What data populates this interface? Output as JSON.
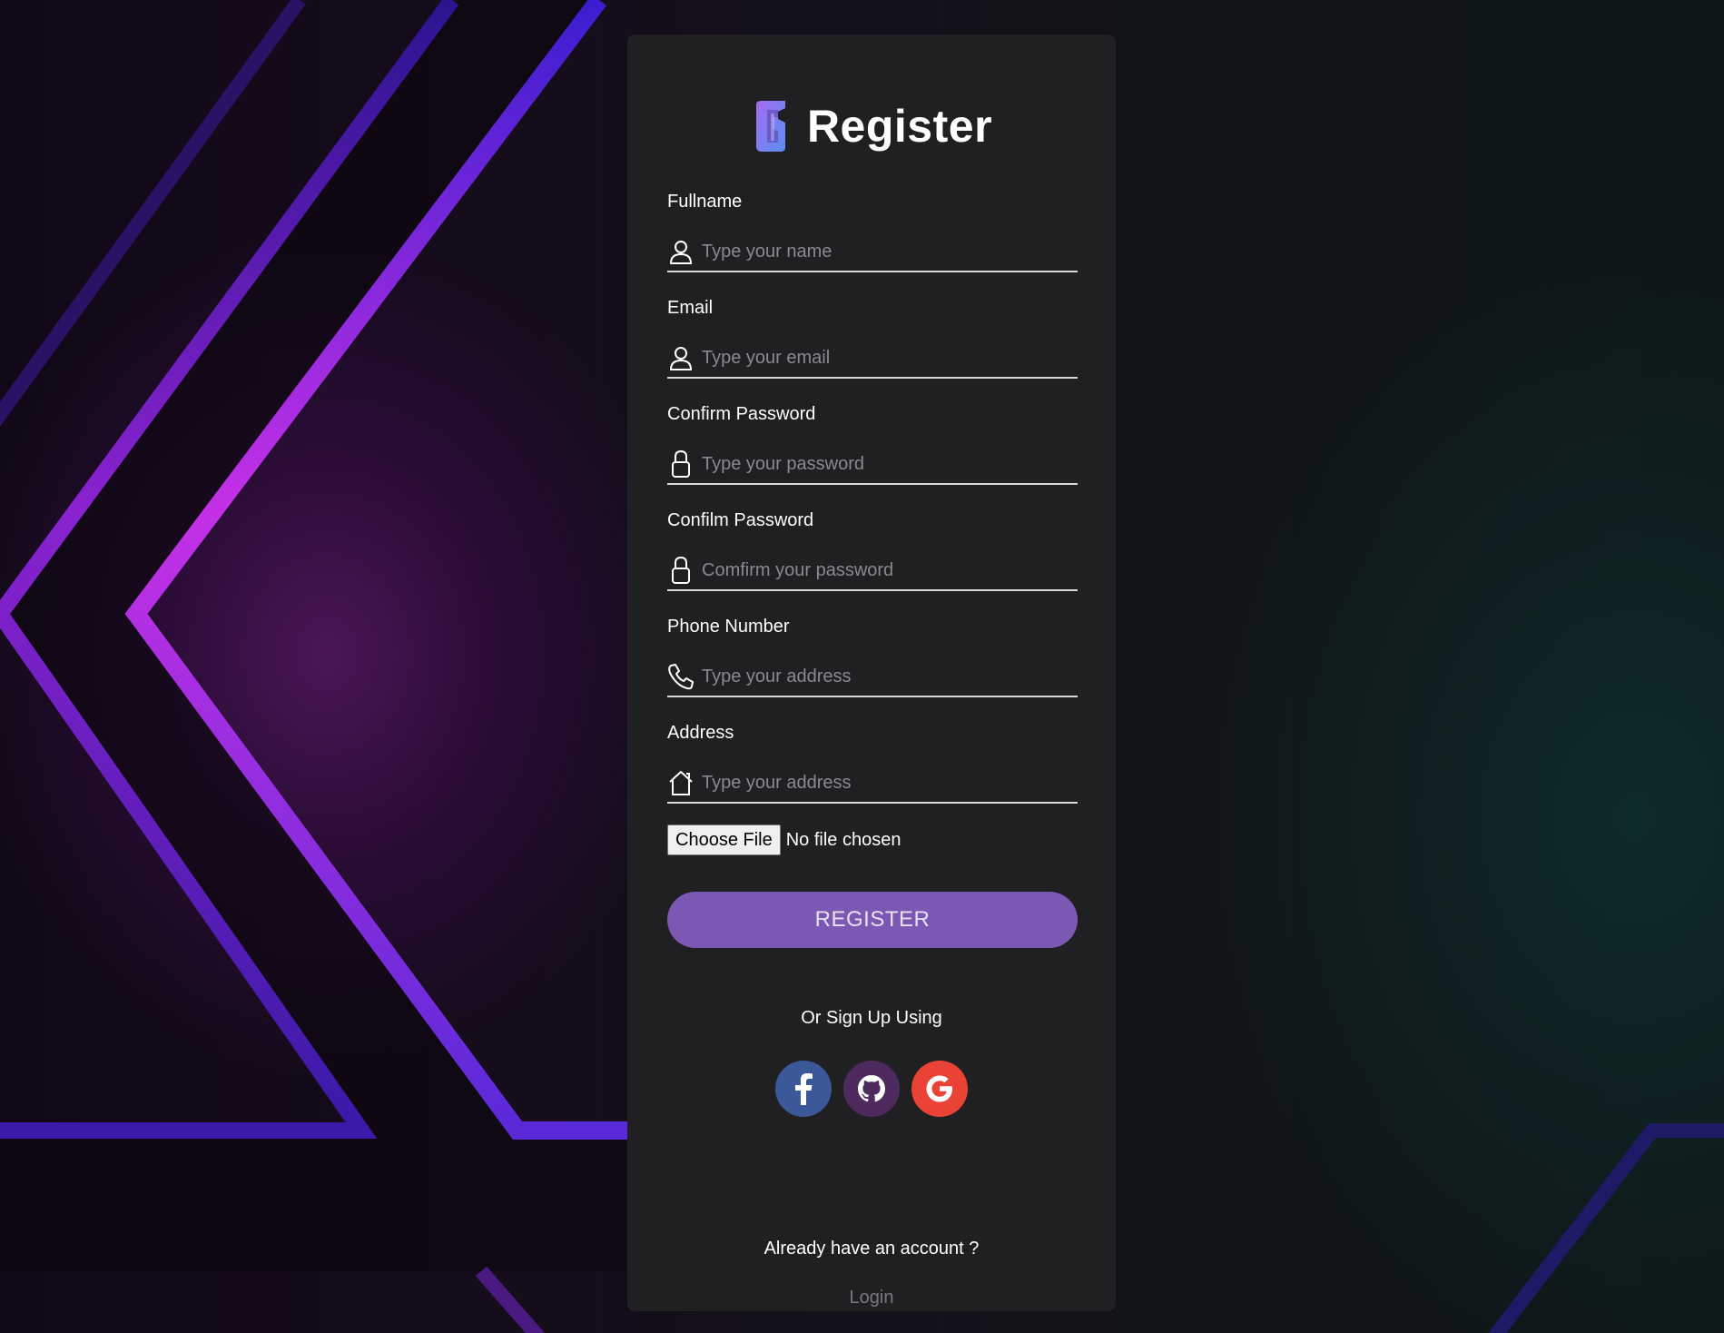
{
  "page": {
    "title": "Register",
    "colors": {
      "card_background": "#202022",
      "accent": "#7b58b3",
      "facebook": "#3b5998",
      "github": "#4e2a5e",
      "google": "#ea4335"
    }
  },
  "form": {
    "fields": [
      {
        "label": "Fullname",
        "placeholder": "Type your name",
        "icon": "user-icon"
      },
      {
        "label": "Email",
        "placeholder": "Type your email",
        "icon": "user-icon"
      },
      {
        "label": "Confirm Password",
        "placeholder": "Type your password",
        "icon": "lock-icon"
      },
      {
        "label": "Confilm Password",
        "placeholder": "Comfirm your password",
        "icon": "lock-icon"
      },
      {
        "label": "Phone Number",
        "placeholder": "Type your address",
        "icon": "phone-icon"
      },
      {
        "label": "Address",
        "placeholder": "Type your address",
        "icon": "home-icon"
      }
    ],
    "file": {
      "button_label": "Choose File",
      "status": "No file chosen"
    },
    "submit_label": "REGISTER"
  },
  "social": {
    "heading": "Or Sign Up Using",
    "buttons": [
      {
        "name": "facebook",
        "icon": "facebook-icon"
      },
      {
        "name": "github",
        "icon": "github-icon"
      },
      {
        "name": "google",
        "icon": "google-icon"
      }
    ]
  },
  "footer": {
    "prompt": "Already have an account ?",
    "login_label": "Login"
  }
}
